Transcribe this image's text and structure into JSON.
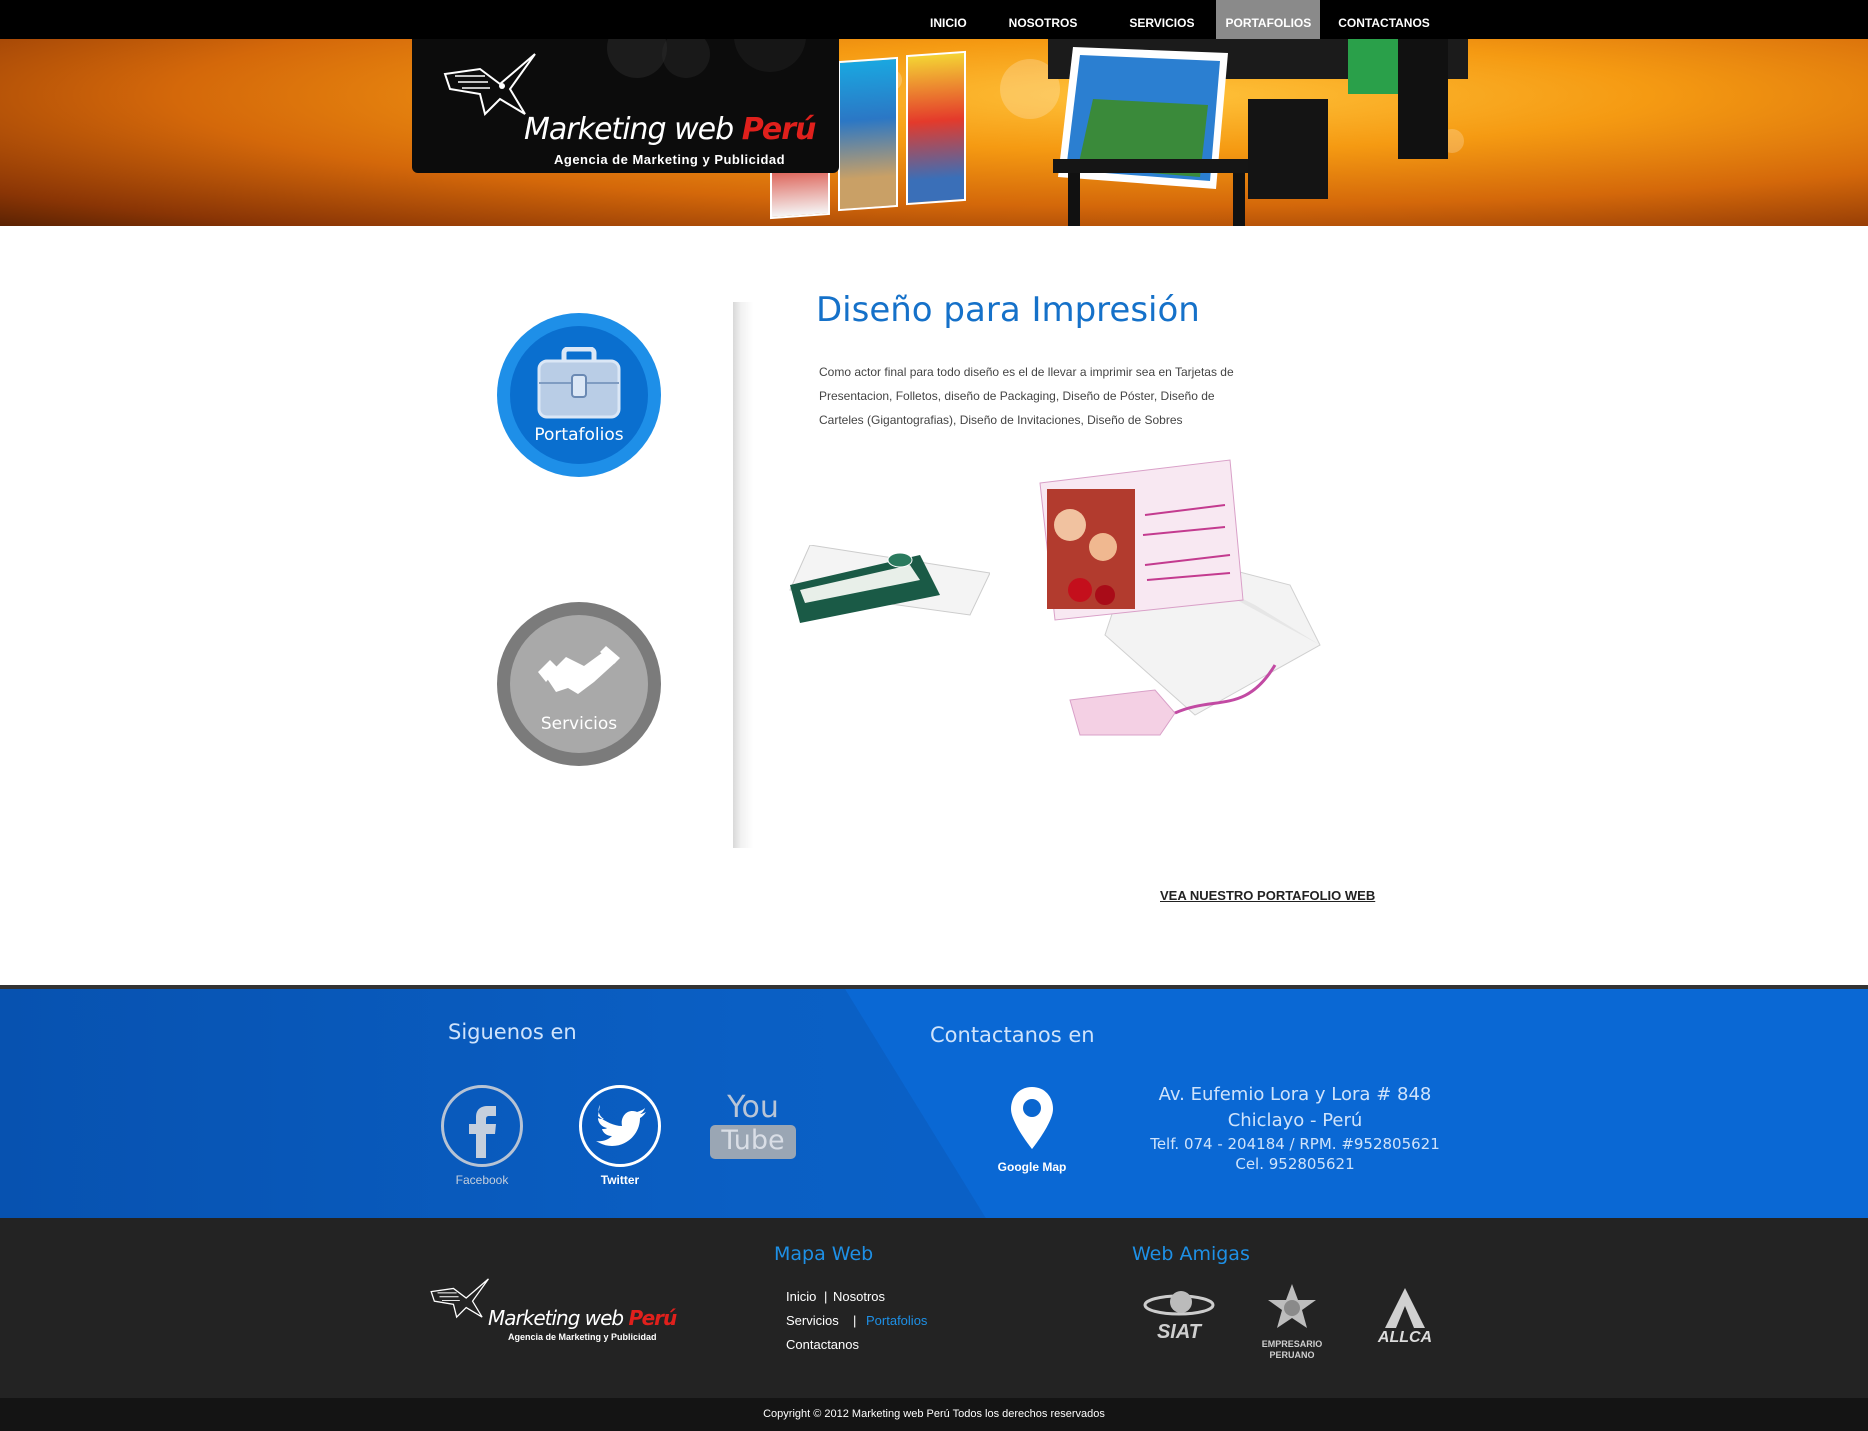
{
  "nav": {
    "items": [
      {
        "label": "INICIO",
        "active": false
      },
      {
        "label": "NOSOTROS",
        "active": false
      },
      {
        "label": "SERVICIOS",
        "active": false
      },
      {
        "label": "PORTAFOLIOS",
        "active": true
      },
      {
        "label": "CONTACTANOS",
        "active": false
      }
    ]
  },
  "header": {
    "logo_main": "Marketing web",
    "logo_accent": "Perú",
    "logo_tagline": "Agencia de Marketing y Publicidad"
  },
  "sidebar": {
    "portfolio_label": "Portafolios",
    "services_label": "Servicios"
  },
  "main": {
    "title": "Diseño para Impresión",
    "description": "Como actor final para todo diseño es el de llevar a imprimir sea en Tarjetas de Presentacion, Folletos, diseño de Packaging, Diseño de Póster, Diseño de Carteles (Gigantografias), Diseño de Invitaciones, Diseño de Sobres",
    "portfolio_link": "VEA NUESTRO PORTAFOLIO WEB"
  },
  "footer_social": {
    "title": "Siguenos en",
    "facebook": "Facebook",
    "twitter": "Twitter",
    "youtube_top": "You",
    "youtube_bottom": "Tube"
  },
  "footer_contact": {
    "title": "Contactanos en",
    "map_label": "Google Map",
    "address_line1": "Av. Eufemio Lora y Lora # 848",
    "address_line2": "Chiclayo - Perú",
    "phone": "Telf. 074 - 204184 / RPM. #952805621",
    "cell": "Cel. 952805621"
  },
  "footer_sitemap": {
    "title": "Mapa Web",
    "inicio": "Inicio",
    "nosotros": "Nosotros",
    "servicios": "Servicios",
    "portafolios": "Portafolios",
    "contactanos": "Contactanos",
    "separator": "|"
  },
  "footer_friends": {
    "title": "Web Amigas",
    "siat": "SIAT",
    "empresario_line1": "EMPRESARIO",
    "empresario_line2": "PERUANO",
    "allca": "ALLCA"
  },
  "copyright": "Copyright © 2012   Marketing web Perú Todos los derechos reservados",
  "colors": {
    "accent_blue": "#1571c9",
    "nav_active": "#8a8a8a",
    "footer_blue": "#0a5fc4",
    "footer_dark": "#232323"
  }
}
